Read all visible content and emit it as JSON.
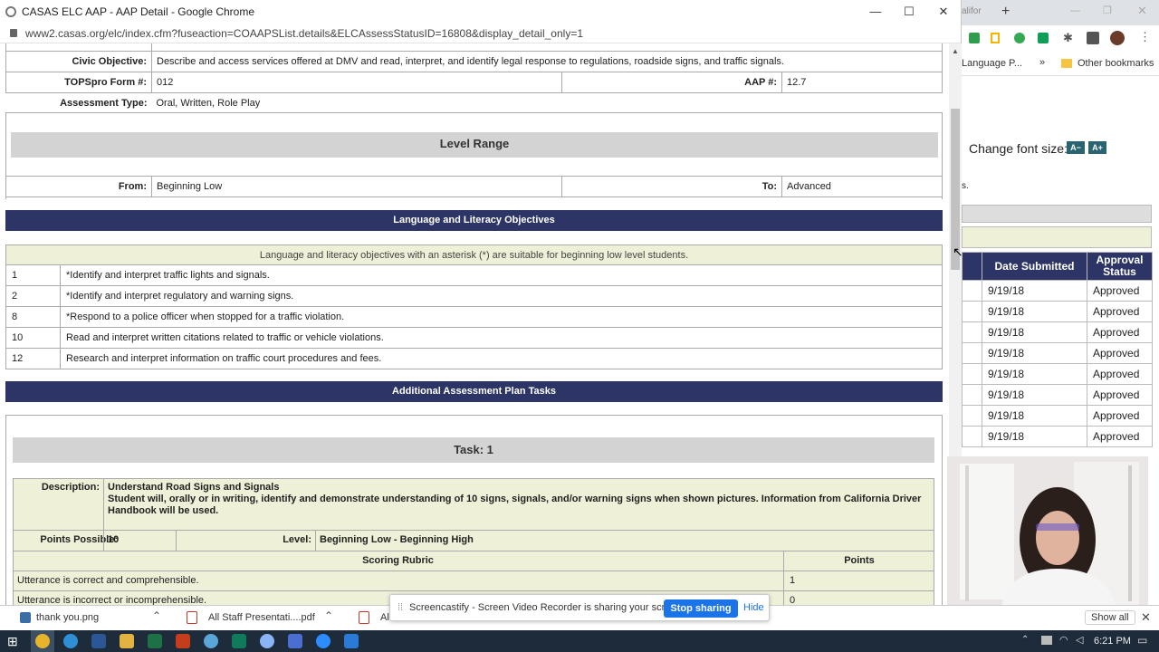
{
  "window": {
    "title": "CASAS ELC AAP - AAP Detail - Google Chrome",
    "url": "www2.casas.org/elc/index.cfm?fuseaction=COAAPSList.details&ELCAssessStatusID=16808&display_detail_only=1"
  },
  "details": {
    "civic_label": "Civic Objective:",
    "civic_value": "Describe and access services offered at DMV and read, interpret, and identify legal response to regulations, roadside signs, and traffic signals.",
    "form_label": "TOPSpro Form #:",
    "form_value": "012",
    "aap_label": "AAP #:",
    "aap_value": "12.7",
    "type_label": "Assessment Type:",
    "type_value": "Oral, Written, Role Play"
  },
  "level_range": {
    "heading": "Level Range",
    "from_label": "From:",
    "from_value": "Beginning Low",
    "to_label": "To:",
    "to_value": "Advanced"
  },
  "lang": {
    "heading": "Language and Literacy Objectives",
    "note": "Language and literacy objectives with an asterisk (*) are suitable for beginning low level students.",
    "items": [
      {
        "num": "1",
        "text": "*Identify and interpret traffic lights and signals."
      },
      {
        "num": "2",
        "text": "*Identify and interpret regulatory and warning signs."
      },
      {
        "num": "8",
        "text": "*Respond to a police officer when stopped for a traffic violation."
      },
      {
        "num": "10",
        "text": "Read and interpret written citations related to traffic or vehicle violations."
      },
      {
        "num": "12",
        "text": "Research and interpret information on traffic court procedures and fees."
      }
    ]
  },
  "tasks": {
    "heading": "Additional Assessment Plan Tasks",
    "task_title": "Task: 1",
    "desc_label": "Description:",
    "desc_title": "Understand Road Signs and Signals",
    "desc_body": "Student will, orally or in writing, identify and demonstrate understanding of 10 signs, signals, and/or warning signs when shown pictures. Information from California Driver Handbook will be used.",
    "points_label": "Points Possible:",
    "points_value": "10",
    "level_label": "Level:",
    "level_value": "Beginning Low - Beginning High",
    "rubric_header": "Scoring Rubric",
    "points_header": "Points",
    "rubric": [
      {
        "text": "Utterance is correct and comprehensible.",
        "points": "1"
      },
      {
        "text": "Utterance is incorrect or incomprehensible.",
        "points": "0"
      }
    ]
  },
  "right": {
    "bookmarks": [
      "Language P...",
      "»",
      "Other bookmarks"
    ],
    "font_size_label": "Change font size:",
    "font_minus": "A−",
    "font_plus": "A+",
    "col_date": "Date Submitted",
    "col_status": "Approval Status",
    "rows": [
      {
        "date": "9/19/18",
        "status": "Approved"
      },
      {
        "date": "9/19/18",
        "status": "Approved"
      },
      {
        "date": "9/19/18",
        "status": "Approved"
      },
      {
        "date": "9/19/18",
        "status": "Approved"
      },
      {
        "date": "9/19/18",
        "status": "Approved"
      },
      {
        "date": "9/19/18",
        "status": "Approved"
      },
      {
        "date": "9/19/18",
        "status": "Approved"
      },
      {
        "date": "9/19/18",
        "status": "Approved"
      }
    ]
  },
  "downloads": {
    "file1": "thank you.png",
    "file2": "All Staff Presentati....pdf",
    "file3": "Al",
    "show_all": "Show all"
  },
  "share_bar": {
    "message": "Screencastify - Screen Video Recorder is sharing your screen.",
    "stop": "Stop sharing",
    "hide": "Hide"
  },
  "taskbar": {
    "time": "6:21 PM"
  },
  "colors": {
    "banner": "#2c3566",
    "tan": "#eef0d8",
    "gray": "#d3d3d3",
    "stop_button": "#1a73e8"
  }
}
